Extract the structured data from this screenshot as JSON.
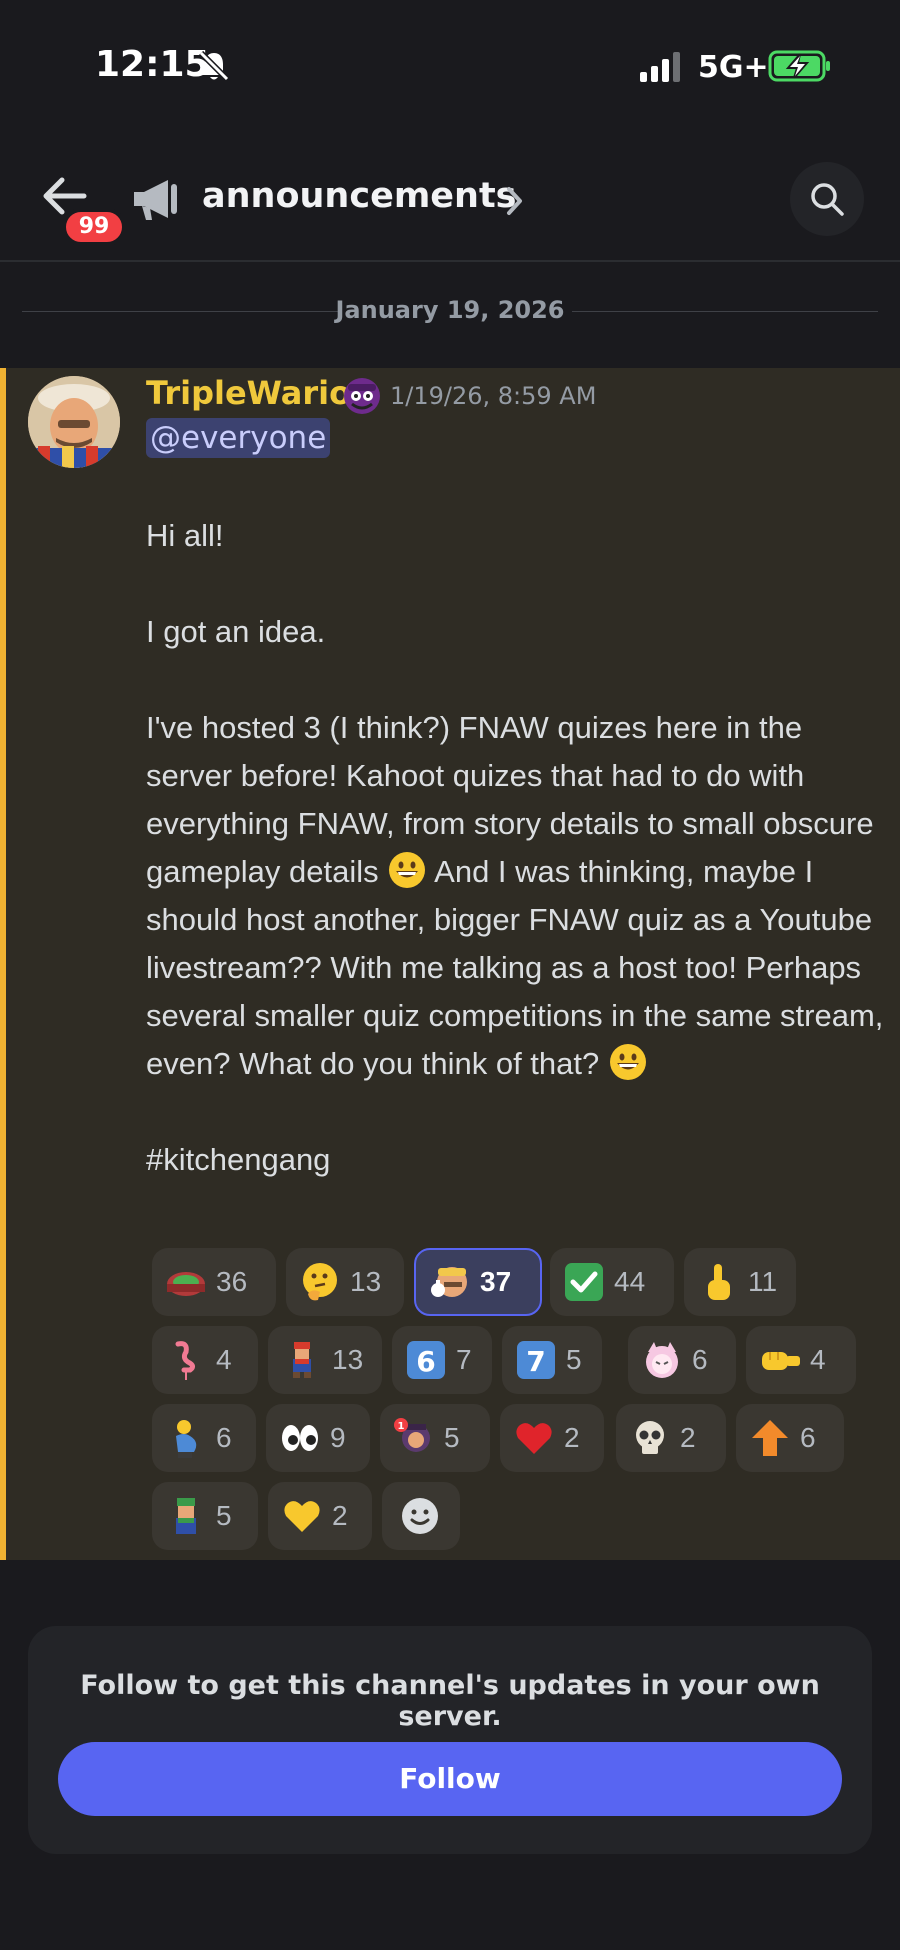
{
  "status_bar": {
    "time": "12:15",
    "network": "5G+"
  },
  "header": {
    "badge": "99",
    "channel_name": "announcements"
  },
  "date_divider": "January 19, 2026",
  "message": {
    "author": "TripleWario",
    "timestamp": "1/19/26, 8:59 AM",
    "mention": "@everyone",
    "p1": "Hi all!",
    "p2": "I got an idea.",
    "p3a": "I've hosted 3 (I think?) FNAW quizes here in the server before! Kahoot quizes that had to do with everything FNAW, from story details to small obscure gameplay details ",
    "p3b": " And I was thinking, maybe I should host another, bigger FNAW quiz as a Youtube livestream?? With me talking as a host too! Perhaps several smaller quiz competitions in the same stream, even? What do you think of that? ",
    "p4": "#kitchengang"
  },
  "reactions": [
    {
      "icon": "stadium-icon",
      "count": "36"
    },
    {
      "icon": "thinking-face-icon",
      "count": "13"
    },
    {
      "icon": "wario-thumbs-icon",
      "count": "37",
      "me": true
    },
    {
      "icon": "check-mark-icon",
      "count": "44"
    },
    {
      "icon": "pointing-up-icon",
      "count": "11"
    },
    {
      "icon": "flamingo-icon",
      "count": "4"
    },
    {
      "icon": "mario-icon",
      "count": "13"
    },
    {
      "icon": "keycap-6-icon",
      "count": "7"
    },
    {
      "icon": "keycap-7-icon",
      "count": "5"
    },
    {
      "icon": "anime-girl-icon",
      "count": "6"
    },
    {
      "icon": "left-fist-icon",
      "count": "4"
    },
    {
      "icon": "pregnant-man-icon",
      "count": "6"
    },
    {
      "icon": "eyes-icon",
      "count": "9"
    },
    {
      "icon": "waluigi-icon",
      "count": "5"
    },
    {
      "icon": "red-heart-icon",
      "count": "2"
    },
    {
      "icon": "skull-icon",
      "count": "2"
    },
    {
      "icon": "up-arrow-icon",
      "count": "6"
    },
    {
      "icon": "luigi-icon",
      "count": "5"
    },
    {
      "icon": "yellow-heart-icon",
      "count": "2"
    },
    {
      "icon": "add-reaction-icon",
      "count": ""
    }
  ],
  "follow": {
    "text": "Follow to get this channel's updates in your own server.",
    "button": "Follow"
  },
  "colors": {
    "accent": "#5865f2",
    "highlight_bar": "#f0b232",
    "author": "#f0c93c"
  }
}
